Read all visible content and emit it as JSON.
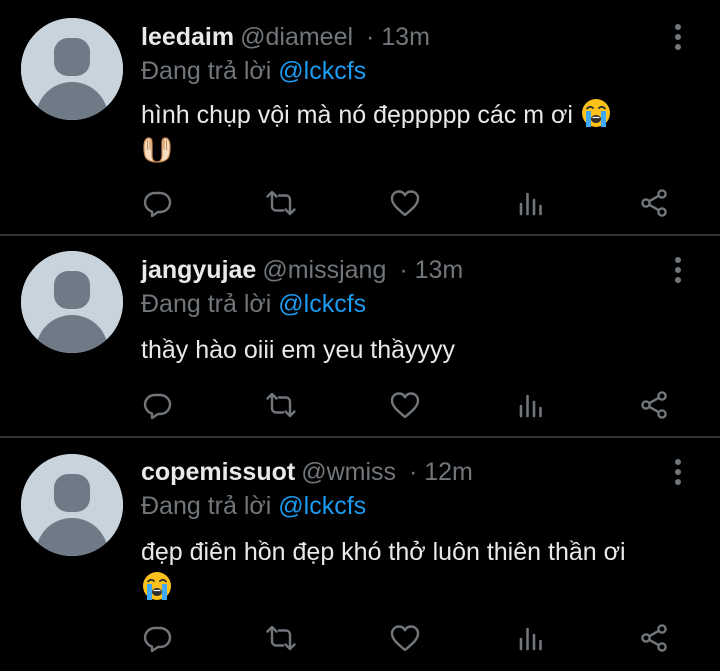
{
  "replying_prefix": "Đang trả lời",
  "colors": {
    "background": "#000000",
    "text": "#e7e9ea",
    "muted": "#71767b",
    "link": "#1d9bf0",
    "divider": "#2f3336",
    "avatar": "#c9d3dc"
  },
  "tweets": [
    {
      "display_name": "leedaim",
      "handle": "@diameel",
      "time": "· 13m",
      "reply_to": "@lckcfs",
      "text": "hình chụp vội mà nó đẹppppp các m ơi",
      "emojis": [
        "loudly-crying-face-emoji",
        "palms-up-together-emoji"
      ]
    },
    {
      "display_name": "jangyujae",
      "handle": "@missjang",
      "time": "· 13m",
      "reply_to": "@lckcfs",
      "text": "thầy hào oiii em yeu thầyyyy",
      "emojis": []
    },
    {
      "display_name": "copemissuot",
      "handle": "@wmiss",
      "time": "· 12m",
      "reply_to": "@lckcfs",
      "text": "đẹp điên hồn đẹp khó thở luôn thiên thần ơi",
      "emojis": [
        "loudly-crying-face-emoji"
      ]
    }
  ],
  "action_icons": [
    "reply-icon",
    "retweet-icon",
    "like-icon",
    "views-icon",
    "share-icon"
  ]
}
